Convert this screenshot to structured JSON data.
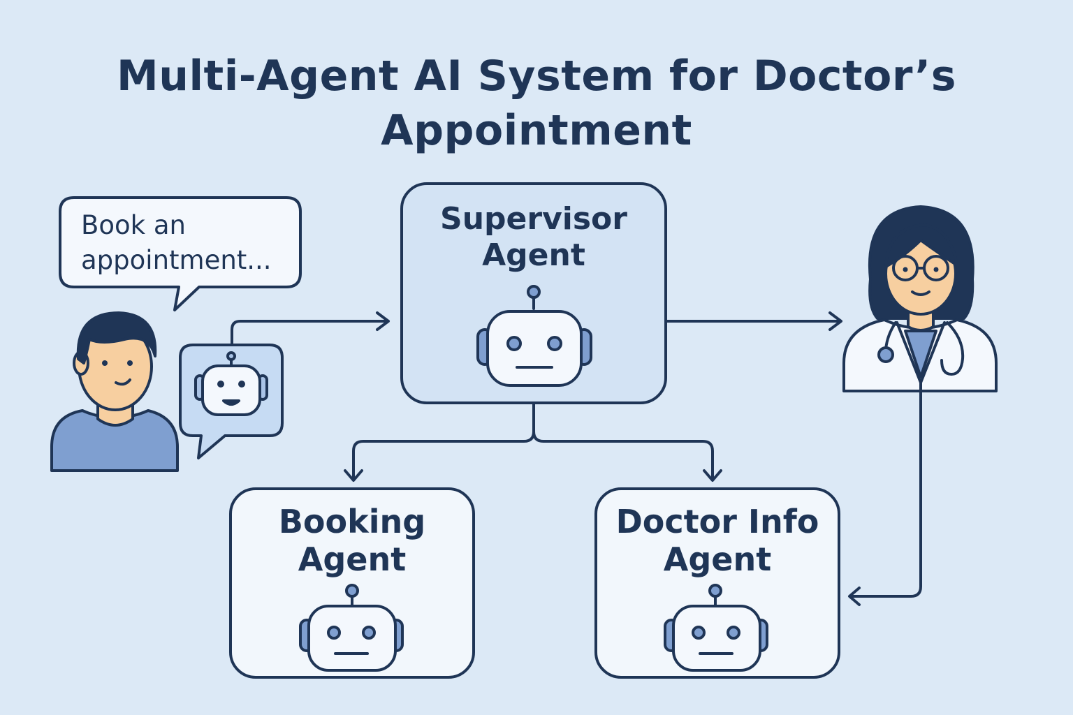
{
  "title": {
    "line1": "Multi-Agent AI System for Doctor’s",
    "line2": "Appointment"
  },
  "user_bubble": {
    "line1": "Book an",
    "line2": "appointment..."
  },
  "nodes": {
    "supervisor": {
      "line1": "Supervisor",
      "line2": "Agent"
    },
    "booking": {
      "line1": "Booking",
      "line2": "Agent"
    },
    "doctor_info": {
      "line1": "Doctor Info",
      "line2": "Agent"
    }
  },
  "colors": {
    "background": "#dce9f6",
    "stroke": "#1f3556",
    "box_fill": "#f2f7fc",
    "supervisor_fill": "#d3e3f4",
    "accent_blue": "#7f9fd0",
    "skin": "#f7cfa0"
  }
}
